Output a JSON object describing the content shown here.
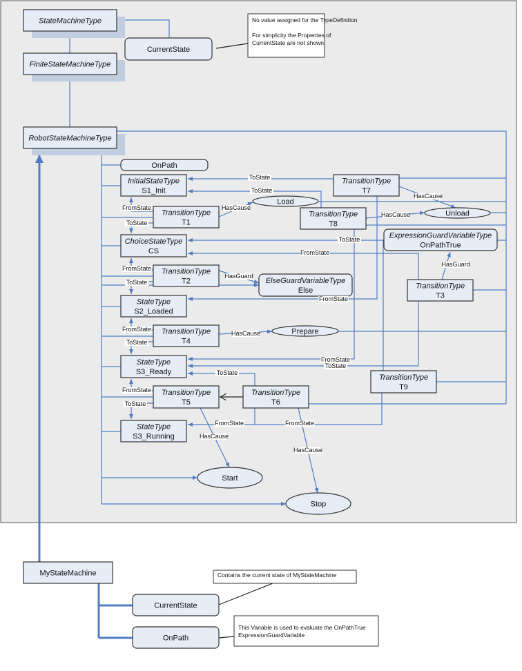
{
  "colors": {
    "panel": "#ebebeb",
    "node_fill": "#e6edf7",
    "reference_line": "#4f7cc4",
    "border": "#333333"
  },
  "nodes": {
    "state_machine_type": {
      "type": "StateMachineType"
    },
    "finite_state_machine_type": {
      "type": "FiniteStateMachineType"
    },
    "robot_state_machine_type": {
      "type": "RobotStateMachineType"
    },
    "current_state": {
      "name": "CurrentState"
    },
    "on_path": {
      "name": "OnPath"
    },
    "s1_init": {
      "type": "InitialStateType",
      "name": "S1_Init"
    },
    "t1": {
      "type": "TransitionType",
      "name": "T1"
    },
    "load": {
      "name": "Load"
    },
    "t7": {
      "type": "TransitionType",
      "name": "T7"
    },
    "t8": {
      "type": "TransitionType",
      "name": "T8"
    },
    "unload": {
      "name": "Unload"
    },
    "cs": {
      "type": "ChoiceStateType",
      "name": "CS"
    },
    "on_path_true": {
      "type": "ExpressionGuardVariableType",
      "name": "OnPathTrue"
    },
    "t2": {
      "type": "TransitionType",
      "name": "T2"
    },
    "else": {
      "type": "ElseGuardVariableType",
      "name": "Else"
    },
    "t3": {
      "type": "TransitionType",
      "name": "T3"
    },
    "s2_loaded": {
      "type": "StateType",
      "name": "S2_Loaded"
    },
    "t4": {
      "type": "TransitionType",
      "name": "T4"
    },
    "prepare": {
      "name": "Prepare"
    },
    "s3_ready": {
      "type": "StateType",
      "name": "S3_Ready"
    },
    "t9": {
      "type": "TransitionType",
      "name": "T9"
    },
    "t5": {
      "type": "TransitionType",
      "name": "T5"
    },
    "t6": {
      "type": "TransitionType",
      "name": "T6"
    },
    "s3_running": {
      "type": "StateType",
      "name": "S3_Running"
    },
    "start": {
      "name": "Start"
    },
    "stop": {
      "name": "Stop"
    },
    "my_state_machine": {
      "name": "MyStateMachine"
    },
    "instance_current_state": {
      "name": "CurrentState"
    },
    "instance_on_path": {
      "name": "OnPath"
    }
  },
  "edge_labels": {
    "from_state": "FromState",
    "to_state": "ToState",
    "has_cause": "HasCause",
    "has_guard": "HasGuard"
  },
  "notes": {
    "type_definition": [
      "No value assigned for the TypeDefinition",
      "",
      "For simplicity the Properties of",
      "CurrentState are not shown"
    ],
    "current_state": [
      "Contains the current state of MyStateMachine"
    ],
    "on_path": [
      "This Variable is used to evaluate the OnPathTrue",
      "ExpressionGuardVariable"
    ]
  }
}
